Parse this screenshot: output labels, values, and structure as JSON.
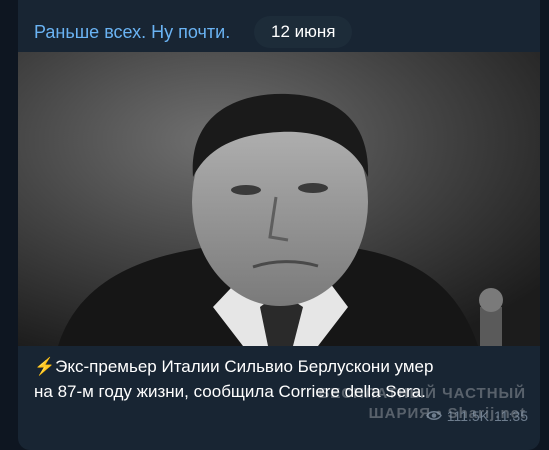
{
  "channel": {
    "name": "Раньше всех. Ну почти."
  },
  "date_separator": {
    "label": "12 июня"
  },
  "photo": {
    "alt": ""
  },
  "message": {
    "emoji": "⚡",
    "text_line1": "Экс-премьер Италии Сильвио Берлускони умер",
    "text_line2": "на 87-м году жизни, сообщила Corriere della Sera.",
    "views": "111.5K",
    "time": "11:35"
  },
  "watermark": {
    "line1": "БЕСПЛАТНЫЙ ЧАСТНЫЙ",
    "line2": "ШАРИЯ • Sharij.net"
  },
  "colors": {
    "accent": "#6ab3f3",
    "bubble": "#182533",
    "background": "#0e1621"
  }
}
